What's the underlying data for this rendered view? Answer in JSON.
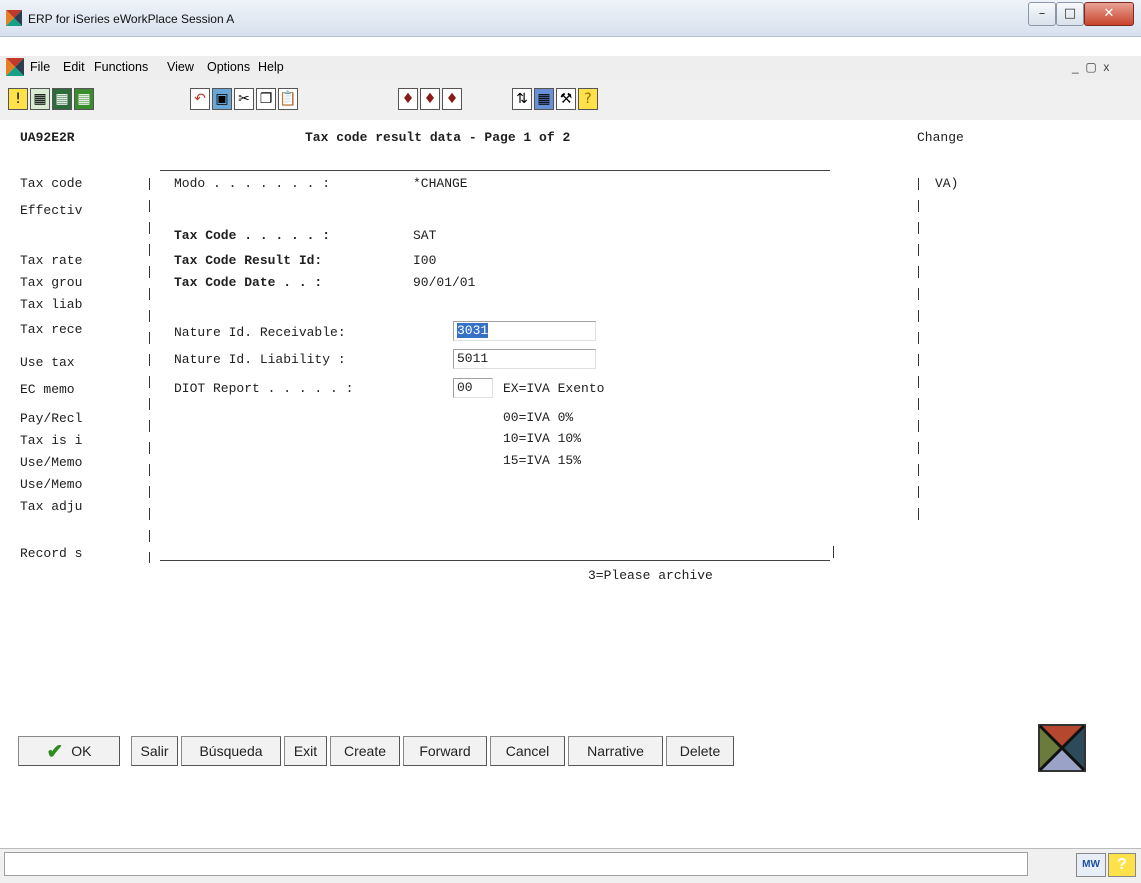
{
  "window": {
    "title": "ERP for iSeries eWorkPlace Session A"
  },
  "menu": {
    "file": "File",
    "edit": "Edit",
    "functions": "Functions",
    "view": "View",
    "options": "Options",
    "help": "Help"
  },
  "header": {
    "program": "UA92E2R",
    "title": "Tax code result data - Page 1 of 2",
    "mode": "Change"
  },
  "left_labels": [
    "Tax code",
    "Effectiv",
    "Tax rate",
    "Tax grou",
    "Tax liab",
    "Tax rece",
    "Use tax",
    "EC memo",
    "Pay/Recl",
    "Tax is i",
    "Use/Memo",
    "Use/Memo",
    "Tax adju",
    "Record s"
  ],
  "right_fragment": "VA)",
  "popup": {
    "modo_label": "Modo . . . . . . . :",
    "modo_value": "*CHANGE",
    "tax_code_label": "Tax Code . . . . . :",
    "tax_code_value": "SAT",
    "result_id_label": "Tax Code Result Id:",
    "result_id_value": "I00",
    "date_label": "Tax Code Date . . :",
    "date_value": "90/01/01",
    "nature_rec_label": "Nature Id. Receivable:",
    "nature_rec_value": "3031",
    "nature_liab_label": "Nature Id. Liability :",
    "nature_liab_value": "5011",
    "diot_label": "DIOT Report . . . . . :",
    "diot_value": "00",
    "diot_options": [
      "EX=IVA Exento",
      "00=IVA 0%",
      "10=IVA 10%",
      "15=IVA 15%"
    ]
  },
  "footer_hint": "3=Please archive",
  "buttons": {
    "ok": "OK",
    "salir": "Salir",
    "busqueda": "Búsqueda",
    "exit": "Exit",
    "create": "Create",
    "forward": "Forward",
    "cancel": "Cancel",
    "narrative": "Narrative",
    "delete": "Delete"
  },
  "status": {
    "mw_badge": "MW",
    "help_badge": "?"
  },
  "colors": {
    "selection": "#3572c6",
    "ok_check": "#2e8b1f"
  }
}
